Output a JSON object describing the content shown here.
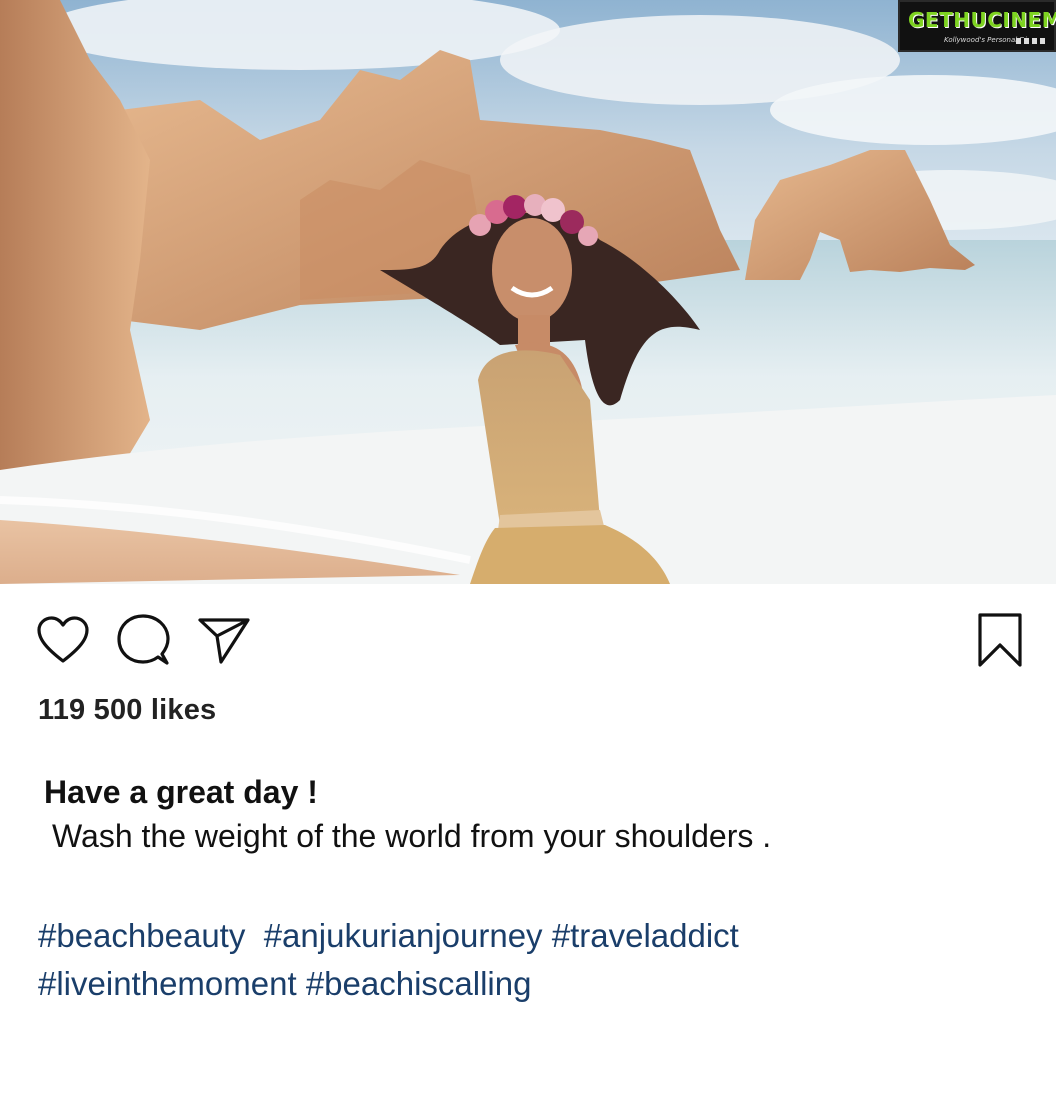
{
  "post": {
    "image_alt": "Woman in a golden dress and flower crown on a beach with sea cliffs",
    "watermark": {
      "brand": "GETHUCINEMA",
      "tagline": "Kollywood's Personal Diary"
    },
    "actions": {
      "like_icon": "heart-icon",
      "comment_icon": "comment-bubble-icon",
      "share_icon": "paper-plane-icon",
      "save_icon": "bookmark-icon"
    },
    "likes_text": "119 500 likes",
    "caption": {
      "title": "Have a great day !",
      "body": "Wash the weight of the world from your shoulders ."
    },
    "hashtags_line1": [
      "#beachbeauty",
      "#anjukurianjourney",
      "#traveladdict"
    ],
    "hashtags_line2": [
      "#liveinthemoment",
      "#beachiscalling"
    ]
  },
  "colors": {
    "hashtag": "#1a3e6a",
    "watermark_green": "#7ed321"
  }
}
